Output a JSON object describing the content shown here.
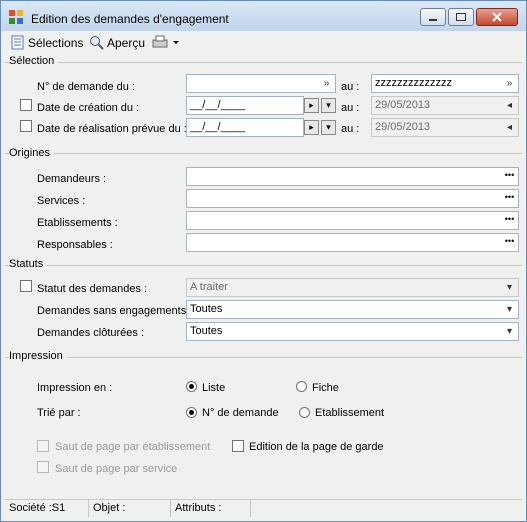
{
  "window": {
    "title": "Edition des demandes d'engagement"
  },
  "toolbar": {
    "selections": "Sélections",
    "apercu": "Aperçu"
  },
  "selection": {
    "heading": "Sélection",
    "num_label": "N° de demande du :",
    "num_from": "",
    "num_to": "zzzzzzzzzzzzzz",
    "au": "au :",
    "creation_label": "Date de création du :",
    "creation_from": "__/__/____",
    "creation_to": "29/05/2013",
    "realisation_label": "Date de réalisation prévue du :",
    "realisation_from": "__/__/____",
    "realisation_to": "29/05/2013"
  },
  "origines": {
    "heading": "Origines",
    "demandeurs": "Demandeurs :",
    "services": "Services :",
    "etablissements": "Etablissements :",
    "responsables": "Responsables :"
  },
  "statuts": {
    "heading": "Statuts",
    "statut_label": "Statut des demandes :",
    "statut_value": "A traiter",
    "sans_label": "Demandes sans engagements :",
    "sans_value": "Toutes",
    "cloturees_label": "Demandes clôturées :",
    "cloturees_value": "Toutes"
  },
  "impression": {
    "heading": "Impression",
    "en_label": "Impression en :",
    "liste": "Liste",
    "fiche": "Fiche",
    "trie_label": "Trié par :",
    "num_demande": "N° de demande",
    "etablissement": "Etablissement",
    "saut_etab": "Saut de page par établissement",
    "edition_garde": "Edition de la page de garde",
    "saut_service": "Saut de page par service"
  },
  "status": {
    "societe": "Société :S1",
    "objet": "Objet :",
    "attributs": "Attributs :"
  }
}
